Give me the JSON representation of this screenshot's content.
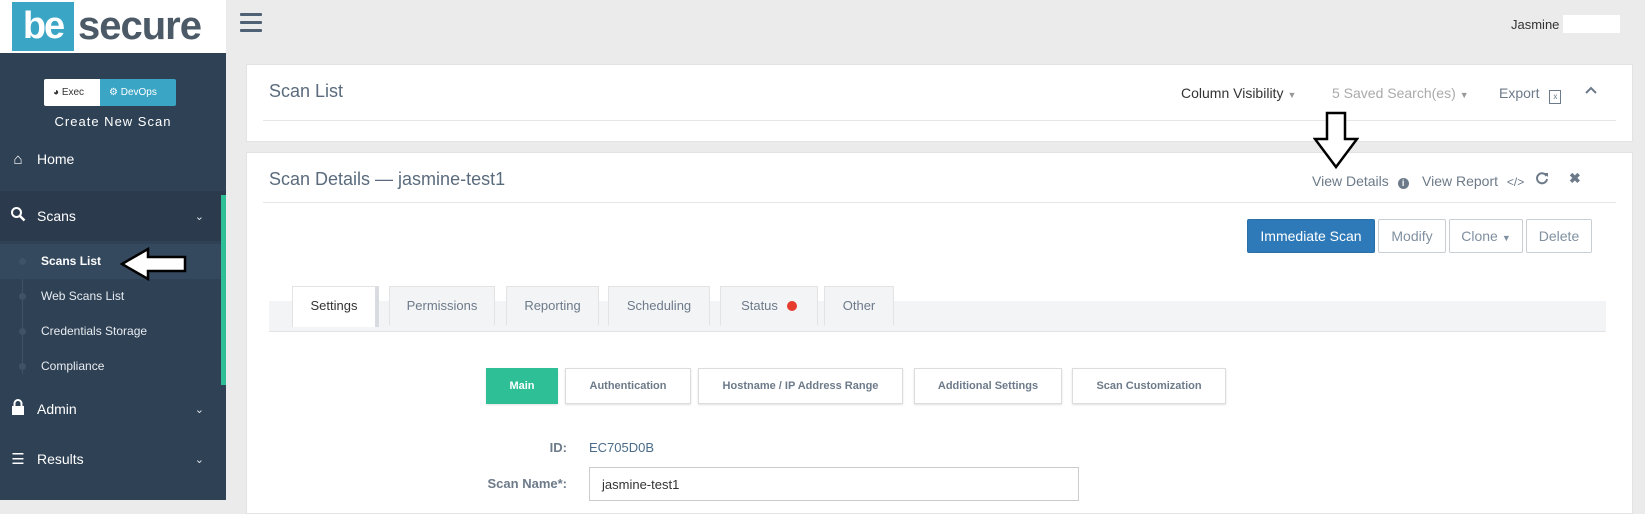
{
  "brand": {
    "logo_be": "be",
    "logo_secure": "secure"
  },
  "sidebar": {
    "toggle": {
      "exec": "Exec",
      "devops": "DevOps"
    },
    "create_new_scan": "Create New Scan",
    "home": "Home",
    "scans": "Scans",
    "sub_items": [
      "Scans List",
      "Web Scans List",
      "Credentials Storage",
      "Compliance"
    ],
    "admin": "Admin",
    "results": "Results"
  },
  "topbar": {
    "username": "Jasmine"
  },
  "scan_list_panel": {
    "title": "Scan List",
    "column_visibility": "Column Visibility",
    "saved_searches": "5 Saved Search(es)",
    "export": "Export"
  },
  "scan_details_panel": {
    "title": "Scan Details — jasmine-test1",
    "view_details": "View Details",
    "view_report": "View Report",
    "buttons": {
      "immediate_scan": "Immediate Scan",
      "modify": "Modify",
      "clone": "Clone",
      "delete": "Delete"
    },
    "tabs": [
      "Settings",
      "Permissions",
      "Reporting",
      "Scheduling",
      "Status",
      "Other"
    ],
    "active_tab": "Settings",
    "subtabs": [
      "Main",
      "Authentication",
      "Hostname / IP Address Range",
      "Additional Settings",
      "Scan Customization"
    ],
    "active_subtab": "Main",
    "form": {
      "id_label": "ID:",
      "id_value": "EC705D0B",
      "scan_name_label": "Scan Name*:",
      "scan_name_value": "jasmine-test1"
    }
  },
  "colors": {
    "sidebar_bg": "#2f4155",
    "accent_green": "#2ebf97",
    "brand_blue": "#3ba5c6",
    "primary_button": "#2e7ab8",
    "status_red": "#e53c2e"
  }
}
